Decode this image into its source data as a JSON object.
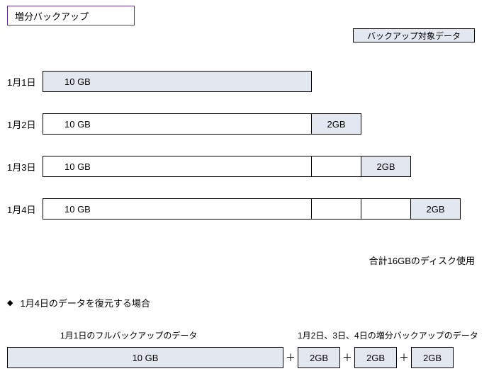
{
  "chart_data": {
    "type": "bar",
    "title": "増分バックアップ",
    "unit": "GB",
    "days": [
      {
        "label": "1月1日",
        "base": 10,
        "backup_segment": "base",
        "increments": []
      },
      {
        "label": "1月2日",
        "base": 10,
        "backup_segment": "inc1",
        "increments": [
          2
        ]
      },
      {
        "label": "1月3日",
        "base": 10,
        "backup_segment": "inc2",
        "increments": [
          2,
          2
        ]
      },
      {
        "label": "1月4日",
        "base": 10,
        "backup_segment": "inc3",
        "increments": [
          2,
          2,
          2
        ]
      }
    ],
    "total_disk_gb": 16,
    "restore_day4": {
      "full": 10,
      "increments": [
        2,
        2,
        2
      ]
    }
  },
  "title": "増分バックアップ",
  "legend": "バックアップ対象データ",
  "days": {
    "d1": {
      "label": "1月1日",
      "base": "10 GB"
    },
    "d2": {
      "label": "1月2日",
      "base": "10 GB",
      "inc": "2GB"
    },
    "d3": {
      "label": "1月3日",
      "base": "10 GB",
      "inc": "2GB"
    },
    "d4": {
      "label": "1月4日",
      "base": "10 GB",
      "inc": "2GB"
    }
  },
  "total": "合計16GBのディスク使用",
  "restore": {
    "bullet": "◆",
    "heading": "1月4日のデータを復元する場合",
    "full_label": "1月1日のフルバックアップのデータ",
    "inc_label": "1月2日、3日、4日の増分バックアップのデータ",
    "full": "10 GB",
    "inc1": "2GB",
    "inc2": "2GB",
    "inc3": "2GB",
    "plus": "＋"
  }
}
